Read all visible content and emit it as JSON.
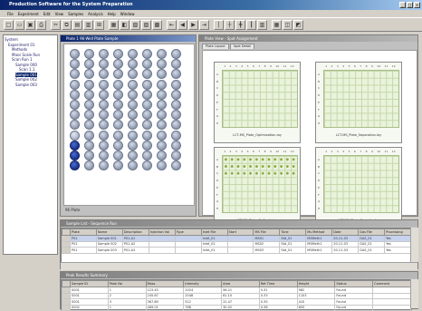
{
  "window": {
    "title": "Production Software for the System Preparation"
  },
  "menu": [
    "File",
    "Experiment",
    "Edit",
    "View",
    "Samples",
    "Analysis",
    "Help",
    "Window"
  ],
  "toolbar": [
    "□",
    "▭",
    "▣",
    "⎙",
    "✂",
    "⧉",
    "▤",
    "▥",
    "⊞",
    "▦",
    "◧",
    "▧",
    "▨",
    "▩",
    "⇤",
    "◀",
    "▶",
    "⇥",
    "│",
    "┼",
    "╋",
    "┃",
    "▥",
    "▦",
    "◫",
    "◩"
  ],
  "tree": {
    "items": [
      {
        "label": "System",
        "indent": 0,
        "selected": false
      },
      {
        "label": "Experiment 01",
        "indent": 1,
        "selected": false
      },
      {
        "label": "Methods",
        "indent": 2,
        "selected": false
      },
      {
        "label": "Mass Scale Run",
        "indent": 2,
        "selected": false
      },
      {
        "label": "Scan Run 1",
        "indent": 2,
        "selected": false
      },
      {
        "label": "Sample 000",
        "indent": 3,
        "selected": false
      },
      {
        "label": "Scan 1.1",
        "indent": 4,
        "selected": false
      },
      {
        "label": "Sample 001",
        "indent": 3,
        "selected": true
      },
      {
        "label": "Sample 002",
        "indent": 3,
        "selected": false
      },
      {
        "label": "Sample 003",
        "indent": 3,
        "selected": false
      }
    ]
  },
  "plate_window": {
    "title": "Plate 1 96-Well Plate Sample",
    "rows": 12,
    "cols": 8,
    "selected_wells": [
      [
        9,
        0
      ],
      [
        10,
        0
      ],
      [
        11,
        0
      ]
    ],
    "footer": "96 Plate"
  },
  "grid_window": {
    "title": "Plate View - Spot Assignment",
    "tabs": [
      "Plate Layout",
      "Spot Detail"
    ],
    "plates": [
      {
        "caption": "LCT-MS_Plate_Optimization.lay",
        "highlight": false
      },
      {
        "caption": "LCT-MS_Plate_Separation.lay",
        "highlight": false
      },
      {
        "caption": "LCT-MS_Plate_Calibrate.lay",
        "highlight": true
      },
      {
        "caption": "LCT-MS_Plate_Samples.lay",
        "highlight": false
      }
    ],
    "col_labels": [
      "1",
      "2",
      "3",
      "4",
      "5",
      "6",
      "7",
      "8",
      "9",
      "10",
      "11",
      "12"
    ],
    "row_labels": [
      "A",
      "B",
      "C",
      "D",
      "E",
      "F",
      "G",
      "H"
    ]
  },
  "sample_table": {
    "title": "Sample List - Sequence Run",
    "headers": [
      "",
      "Plate",
      "Name",
      "Description",
      "Injection Vol",
      "Type",
      "Inlet File",
      "Start",
      "MS File",
      "Tune",
      "Ms Method",
      "Date",
      "Gas File",
      "Processing"
    ],
    "rows": [
      [
        "",
        "P01",
        "Sample 001",
        "P01-A1",
        "",
        "",
        "Inlet_01",
        "",
        "MS01",
        "Std_01",
        "MSMeth1",
        "20-11-03",
        "GAS_01",
        "Yes"
      ],
      [
        "",
        "P01",
        "Sample 002",
        "P01-A2",
        "",
        "",
        "Inlet_01",
        "",
        "MS02",
        "Std_01",
        "MSMeth1",
        "20-11-03",
        "GAS_01",
        "Yes"
      ],
      [
        "",
        "P01",
        "Sample 003",
        "P01-A3",
        "",
        "",
        "Inlet_01",
        "",
        "MS03",
        "Std_01",
        "MSMeth1",
        "20-11-03",
        "GAS_01",
        "Yes"
      ]
    ]
  },
  "results_table": {
    "title": "Peak Results Summary",
    "headers": [
      "",
      "Sample ID",
      "Peak No",
      "Mass",
      "Intensity",
      "Area",
      "Ret Time",
      "Height",
      "Status",
      "Comment"
    ],
    "rows": [
      [
        "",
        "S001",
        "1",
        "123.45",
        "1024",
        "56.21",
        "0.31",
        "982",
        "Found",
        ""
      ],
      [
        "",
        "S001",
        "2",
        "245.67",
        "2048",
        "61.10",
        "0.33",
        "1103",
        "Found",
        ""
      ],
      [
        "",
        "S001",
        "3",
        "367.89",
        "512",
        "22.47",
        "0.35",
        "410",
        "Found",
        ""
      ],
      [
        "",
        "S002",
        "1",
        "489.01",
        "768",
        "30.02",
        "0.38",
        "655",
        "Found",
        ""
      ]
    ]
  }
}
